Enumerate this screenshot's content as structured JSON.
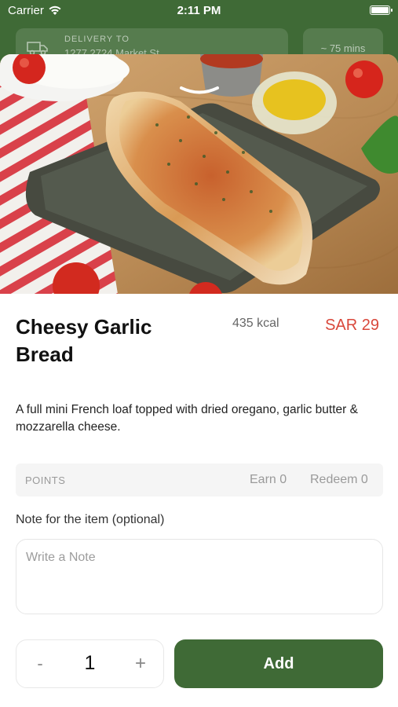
{
  "status_bar": {
    "carrier": "Carrier",
    "time": "2:11 PM"
  },
  "header": {
    "delivery_label": "DELIVERY TO",
    "delivery_address": "1277 2724 Market St",
    "eta": "~ 75 mins"
  },
  "item": {
    "name": "Cheesy Garlic Bread",
    "kcal": "435 kcal",
    "price": "SAR 29",
    "description": "A full mini French loaf topped with dried oregano, garlic butter & mozzarella cheese."
  },
  "points": {
    "label": "POINTS",
    "earn": "Earn 0",
    "redeem": "Redeem 0"
  },
  "note": {
    "label": "Note for the item (optional)",
    "placeholder": "Write a Note",
    "value": ""
  },
  "quantity": {
    "minus": "-",
    "value": "1",
    "plus": "+"
  },
  "add_button": {
    "label": "Add"
  },
  "colors": {
    "brand": "#3f6a36",
    "price": "#d9483b"
  }
}
